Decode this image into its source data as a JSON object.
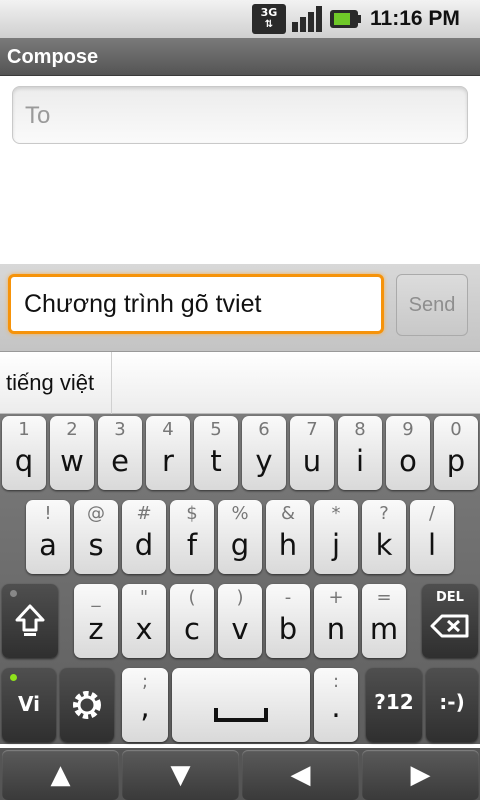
{
  "status_bar": {
    "network_label": "3G",
    "time": "11:16 PM",
    "icons": [
      "3g-data-icon",
      "signal-strength-icon",
      "battery-charging-icon"
    ],
    "battery_color": "#6fc828"
  },
  "title_bar": {
    "title": "Compose"
  },
  "compose": {
    "to_placeholder": "To",
    "message_text": "Chương trình gõ tviet",
    "send_label": "Send",
    "focus_color": "#f6930a"
  },
  "candidates": [
    "tiếng việt"
  ],
  "keyboard": {
    "row1": [
      {
        "main": "q",
        "sub": "1"
      },
      {
        "main": "w",
        "sub": "2"
      },
      {
        "main": "e",
        "sub": "3"
      },
      {
        "main": "r",
        "sub": "4"
      },
      {
        "main": "t",
        "sub": "5"
      },
      {
        "main": "y",
        "sub": "6"
      },
      {
        "main": "u",
        "sub": "7"
      },
      {
        "main": "i",
        "sub": "8"
      },
      {
        "main": "o",
        "sub": "9"
      },
      {
        "main": "p",
        "sub": "0"
      }
    ],
    "row2": [
      {
        "main": "a",
        "sub": "!"
      },
      {
        "main": "s",
        "sub": "@"
      },
      {
        "main": "d",
        "sub": "#"
      },
      {
        "main": "f",
        "sub": "$"
      },
      {
        "main": "g",
        "sub": "%"
      },
      {
        "main": "h",
        "sub": "&"
      },
      {
        "main": "j",
        "sub": "*"
      },
      {
        "main": "k",
        "sub": "?"
      },
      {
        "main": "l",
        "sub": "/"
      }
    ],
    "row3": [
      {
        "main": "z",
        "sub": "_"
      },
      {
        "main": "x",
        "sub": "\""
      },
      {
        "main": "c",
        "sub": "("
      },
      {
        "main": "v",
        "sub": ")"
      },
      {
        "main": "b",
        "sub": "-"
      },
      {
        "main": "n",
        "sub": "+"
      },
      {
        "main": "m",
        "sub": "="
      }
    ],
    "shift_icon": "shift-icon",
    "del_label": "DEL",
    "lang_label": "Vi",
    "settings_icon": "gear-icon",
    "comma_main": ",",
    "comma_sub": ";",
    "period_main": ".",
    "period_sub": ":",
    "symbols_label": "?12",
    "smiley_label": ":-)"
  },
  "nav_keys": [
    {
      "name": "up-arrow-icon",
      "glyph": "▲"
    },
    {
      "name": "down-arrow-icon",
      "glyph": "▼"
    },
    {
      "name": "left-arrow-icon",
      "glyph": "◀"
    },
    {
      "name": "right-arrow-icon",
      "glyph": "▶"
    }
  ]
}
